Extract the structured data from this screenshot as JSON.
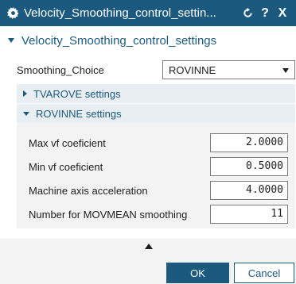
{
  "window": {
    "title": "Velocity_Smoothing_control_settin...",
    "buttons": {
      "reset_icon": "reset-icon",
      "help_label": "?",
      "close_label": "X"
    }
  },
  "section": {
    "title": "Velocity_Smoothing_control_settings"
  },
  "smoothing_choice": {
    "label": "Smoothing_Choice",
    "selected": "ROVINNE"
  },
  "groups": {
    "tvarove": {
      "label": "TVAROVE settings",
      "expanded": false
    },
    "rovinne": {
      "label": "ROVINNE settings",
      "expanded": true
    }
  },
  "fields": [
    {
      "label": "Max vf coeficient",
      "value": "2.0000"
    },
    {
      "label": "Min vf coeficient",
      "value": "0.5000"
    },
    {
      "label": "Machine axis acceleration",
      "value": "4.0000"
    },
    {
      "label": "Number for MOVMEAN smoothing",
      "value": "11"
    }
  ],
  "footer": {
    "ok_label": "OK",
    "cancel_label": "Cancel"
  },
  "colors": {
    "accent": "#1b5a7e",
    "panel": "#f3f3f3",
    "group_header": "#e8eef2"
  }
}
